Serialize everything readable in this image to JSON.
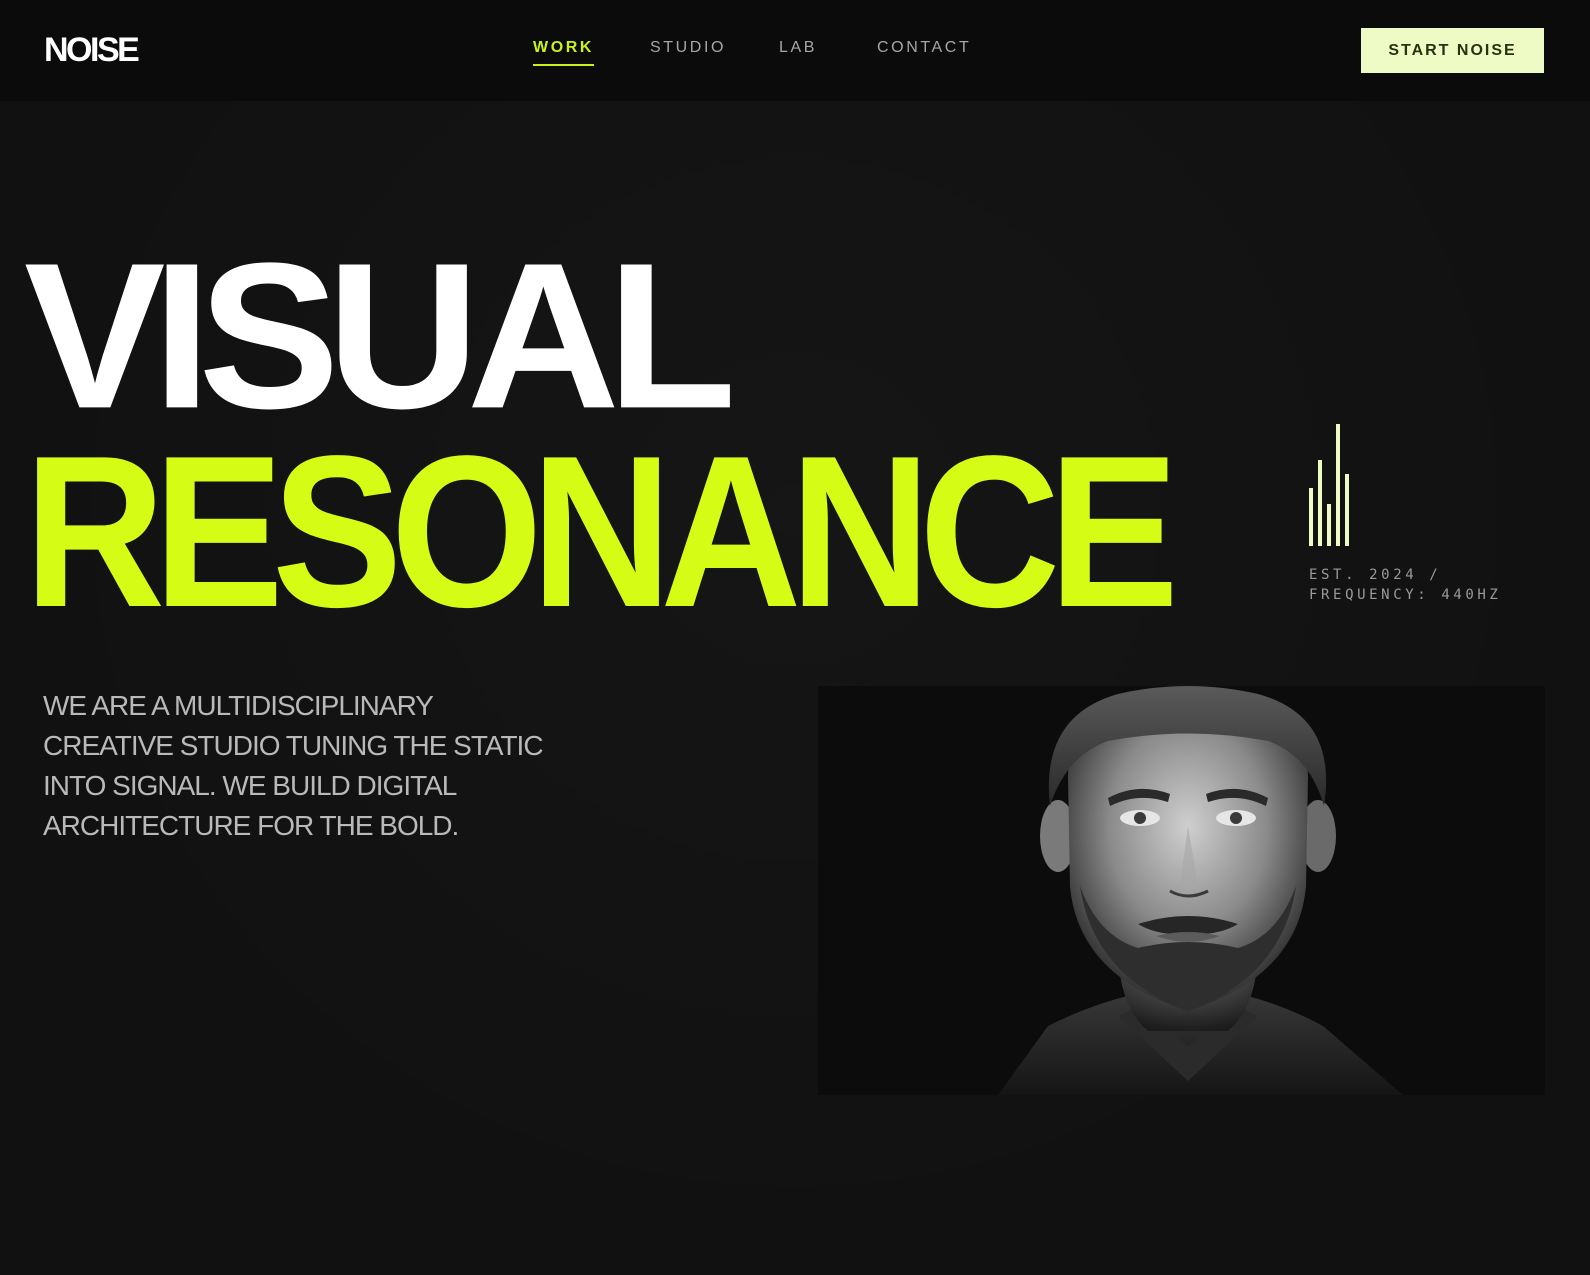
{
  "brand": {
    "logo": "NOISE"
  },
  "nav": {
    "items": [
      {
        "label": "WORK",
        "active": true
      },
      {
        "label": "STUDIO",
        "active": false
      },
      {
        "label": "LAB",
        "active": false
      },
      {
        "label": "CONTACT",
        "active": false
      }
    ]
  },
  "header": {
    "cta_label": "START NOISE"
  },
  "hero": {
    "line1": "VISUAL",
    "line2": "RESONANCE",
    "meta_line1": "EST. 2024 /",
    "meta_line2": "FREQUENCY: 440HZ",
    "description": "WE ARE A MULTIDISCIPLINARY CREATIVE STUDIO TUNING THE STATIC INTO SIGNAL. WE BUILD DIGITAL ARCHITECTURE FOR THE BOLD."
  },
  "icons": {
    "frequency_bars": "equalizer-bars-icon"
  },
  "colors": {
    "background": "#111111",
    "accent": "#d4fc14",
    "cta_background": "#eefbc4",
    "nav_inactive": "#a6a6a6"
  }
}
